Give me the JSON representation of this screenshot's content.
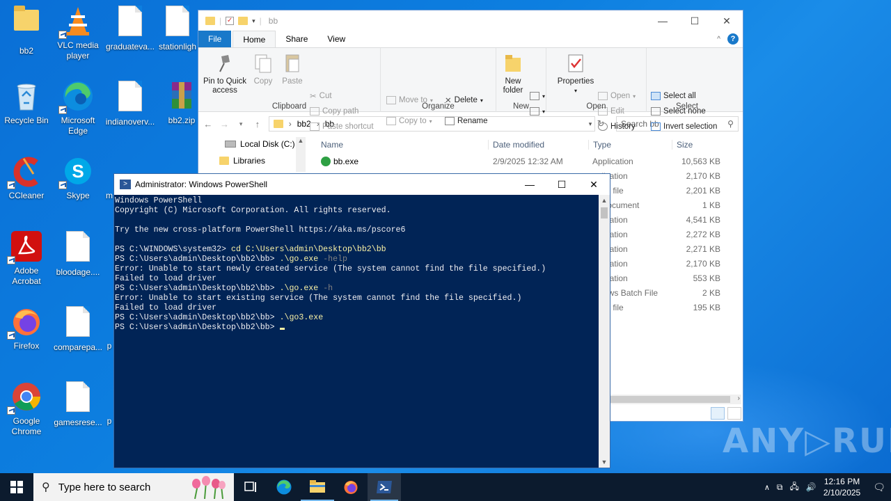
{
  "desktop": {
    "icons": [
      {
        "label": "bb2"
      },
      {
        "label": "VLC media player"
      },
      {
        "label": "graduateva..."
      },
      {
        "label": "stationligh"
      },
      {
        "label": "Recycle Bin"
      },
      {
        "label": "Microsoft Edge"
      },
      {
        "label": "indianoverv..."
      },
      {
        "label": "bb2.zip"
      },
      {
        "label": "CCleaner"
      },
      {
        "label": "Skype"
      },
      {
        "label": "m"
      },
      {
        "label": "Adobe Acrobat"
      },
      {
        "label": "bloodage...."
      },
      {
        "label": "Firefox"
      },
      {
        "label": "comparepa..."
      },
      {
        "label": "p"
      },
      {
        "label": "Google Chrome"
      },
      {
        "label": "gamesrese..."
      },
      {
        "label": "p"
      }
    ]
  },
  "explorer": {
    "title": "bb",
    "tabs": {
      "file": "File",
      "home": "Home",
      "share": "Share",
      "view": "View"
    },
    "ribbon": {
      "clipboard": {
        "label": "Clipboard",
        "pin": "Pin to Quick access",
        "copy": "Copy",
        "paste": "Paste",
        "cut": "Cut",
        "copy_path": "Copy path",
        "paste_shortcut": "Paste shortcut"
      },
      "organize": {
        "label": "Organize",
        "move_to": "Move to",
        "copy_to": "Copy to",
        "delete": "Delete",
        "rename": "Rename"
      },
      "new": {
        "label": "New",
        "new_folder": "New folder"
      },
      "open": {
        "label": "Open",
        "properties": "Properties",
        "open": "Open",
        "edit": "Edit",
        "history": "History"
      },
      "select": {
        "label": "Select",
        "select_all": "Select all",
        "select_none": "Select none",
        "invert": "Invert selection"
      }
    },
    "breadcrumb": [
      "bb2",
      "bb"
    ],
    "search_placeholder": "Search bb",
    "nav": [
      {
        "label": "Local Disk (C:)"
      },
      {
        "label": "Libraries"
      }
    ],
    "columns": {
      "name": "Name",
      "date": "Date modified",
      "type": "Type",
      "size": "Size"
    },
    "files": [
      {
        "name": "bb.exe",
        "date": "2/9/2025 12:32 AM",
        "type": "Application",
        "size": "10,563 KB"
      },
      {
        "name": "",
        "date": "",
        "type": "pplication",
        "size": "2,170 KB"
      },
      {
        "name": "",
        "date": "",
        "type": "stem file",
        "size": "2,201 KB"
      },
      {
        "name": "",
        "date": "",
        "type": "xt Document",
        "size": "1 KB"
      },
      {
        "name": "",
        "date": "",
        "type": "pplication",
        "size": "4,541 KB"
      },
      {
        "name": "",
        "date": "",
        "type": "pplication",
        "size": "2,272 KB"
      },
      {
        "name": "",
        "date": "",
        "type": "pplication",
        "size": "2,271 KB"
      },
      {
        "name": "",
        "date": "",
        "type": "pplication",
        "size": "2,170 KB"
      },
      {
        "name": "",
        "date": "",
        "type": "pplication",
        "size": "553 KB"
      },
      {
        "name": "",
        "date": "",
        "type": "indows Batch File",
        "size": "2 KB"
      },
      {
        "name": "",
        "date": "",
        "type": "stem file",
        "size": "195 KB"
      }
    ]
  },
  "powershell": {
    "title": "Administrator: Windows PowerShell",
    "lines": [
      {
        "prompt": "Windows PowerShell",
        "cmd": "",
        "param": ""
      },
      {
        "prompt": "Copyright (C) Microsoft Corporation. All rights reserved.",
        "cmd": "",
        "param": ""
      },
      {
        "prompt": "",
        "cmd": "",
        "param": ""
      },
      {
        "prompt": "Try the new cross-platform PowerShell https://aka.ms/pscore6",
        "cmd": "",
        "param": ""
      },
      {
        "prompt": "",
        "cmd": "",
        "param": ""
      },
      {
        "prompt": "PS C:\\WINDOWS\\system32> ",
        "cmd": "cd C:\\Users\\admin\\Desktop\\bb2\\bb",
        "param": ""
      },
      {
        "prompt": "PS C:\\Users\\admin\\Desktop\\bb2\\bb> ",
        "cmd": ".\\go.exe ",
        "param": "-help"
      },
      {
        "prompt": "Error: Unable to start newly created service (The system cannot find the file specified.)",
        "cmd": "",
        "param": ""
      },
      {
        "prompt": "Failed to load driver",
        "cmd": "",
        "param": ""
      },
      {
        "prompt": "PS C:\\Users\\admin\\Desktop\\bb2\\bb> ",
        "cmd": ".\\go.exe ",
        "param": "-h"
      },
      {
        "prompt": "Error: Unable to start existing service (The system cannot find the file specified.)",
        "cmd": "",
        "param": ""
      },
      {
        "prompt": "Failed to load driver",
        "cmd": "",
        "param": ""
      },
      {
        "prompt": "PS C:\\Users\\admin\\Desktop\\bb2\\bb> ",
        "cmd": ".\\go3.exe",
        "param": ""
      },
      {
        "prompt": "PS C:\\Users\\admin\\Desktop\\bb2\\bb> ",
        "cmd": "",
        "param": ""
      }
    ]
  },
  "watermark": "ANY▷RUN",
  "taskbar": {
    "search_placeholder": "Type here to search",
    "time": "12:16 PM",
    "date": "2/10/2025"
  }
}
